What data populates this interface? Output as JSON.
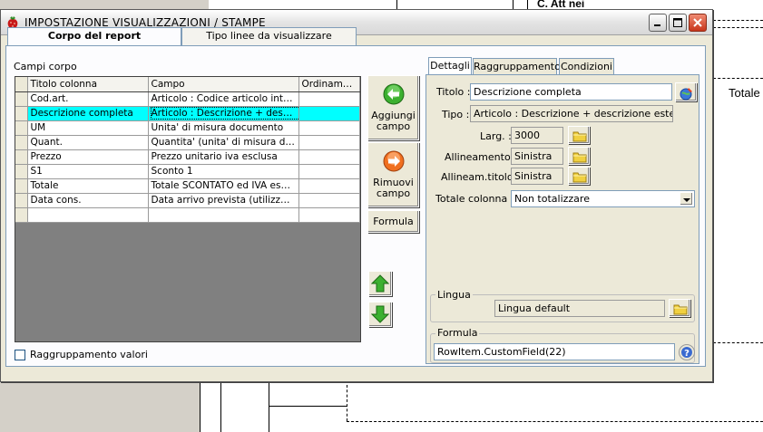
{
  "background": {
    "strip_text": "Totale",
    "header_text": "C. Att nei"
  },
  "window": {
    "title": "IMPOSTAZIONE VISUALIZZAZIONI / STAMPE"
  },
  "tabs": [
    {
      "label": "Corpo del report"
    },
    {
      "label": "Tipo linee da visualizzare"
    }
  ],
  "campi_corpo_label": "Campi corpo",
  "grid": {
    "columns": [
      "Titolo colonna",
      "Campo",
      "Ordinamento"
    ],
    "rows": [
      {
        "titolo": "Cod.art.",
        "campo": "Articolo : Codice articolo intestat...",
        "ordinamento": ""
      },
      {
        "titolo": "Descrizione completa",
        "campo": "Articolo : Descrizione + descrizio...",
        "ordinamento": ""
      },
      {
        "titolo": "UM",
        "campo": "Unita' di misura documento",
        "ordinamento": ""
      },
      {
        "titolo": "Quant.",
        "campo": "Quantita' (unita' di misura docum...",
        "ordinamento": ""
      },
      {
        "titolo": "Prezzo",
        "campo": "Prezzo unitario iva esclusa",
        "ordinamento": ""
      },
      {
        "titolo": "S1",
        "campo": "Sconto 1",
        "ordinamento": ""
      },
      {
        "titolo": "Totale",
        "campo": "Totale SCONTATO ed IVA escl...",
        "ordinamento": ""
      },
      {
        "titolo": "Data cons.",
        "campo": "Data arrivo prevista (utilizza dat...",
        "ordinamento": ""
      },
      {
        "titolo": "",
        "campo": "",
        "ordinamento": ""
      }
    ]
  },
  "buttons": {
    "aggiungi_line1": "Aggiungi",
    "aggiungi_line2": "campo",
    "rimuovi_line1": "Rimuovi",
    "rimuovi_line2": "campo",
    "formula": "Formula"
  },
  "raggruppamento_valori": "Raggruppamento valori",
  "right_tabs": [
    {
      "label": "Dettagli"
    },
    {
      "label": "Raggruppamento"
    },
    {
      "label": "Condizioni"
    }
  ],
  "details": {
    "titolo_label": "Titolo :",
    "titolo_value": "Descrizione completa",
    "tipo_label": "Tipo :",
    "tipo_value": "Articolo : Descrizione + descrizione estesa",
    "larg_label": "Larg. :",
    "larg_value": "3000",
    "allineamento_label": "Allineamento :",
    "allineamento_value": "Sinistra",
    "allineam_titolo_label": "Allineam.titolo :",
    "allineam_titolo_value": "Sinistra",
    "totale_colonna_label": "Totale colonna :",
    "totale_colonna_value": "Non totalizzare",
    "lingua_group": "Lingua",
    "lingua_value": "Lingua default",
    "formula_group": "Formula",
    "formula_value": "RowItem.CustomField(22)"
  },
  "colors": {
    "selected_row": "#00ffff",
    "add_green": "#3cb030",
    "remove_orange": "#f07020",
    "close_red": "#c8361c"
  }
}
